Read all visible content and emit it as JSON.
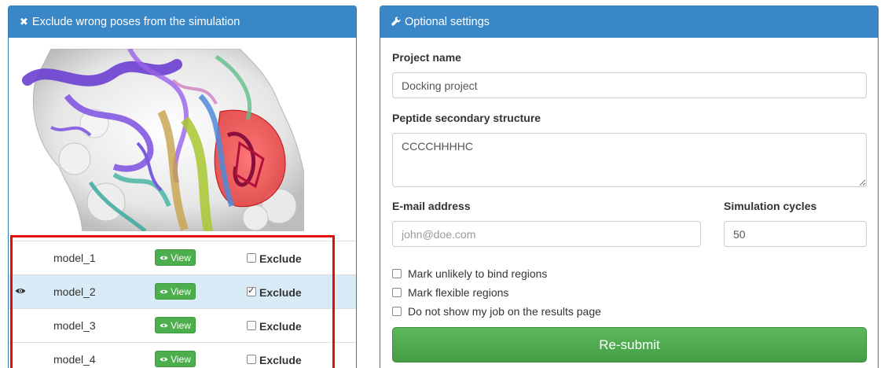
{
  "left_panel": {
    "title": "Exclude wrong poses from the simulation",
    "title_icon": "close-icon",
    "models": [
      {
        "name": "model_1",
        "view_label": "View",
        "exclude_label": "Exclude",
        "excluded": false,
        "selected": false
      },
      {
        "name": "model_2",
        "view_label": "View",
        "exclude_label": "Exclude",
        "excluded": true,
        "selected": true
      },
      {
        "name": "model_3",
        "view_label": "View",
        "exclude_label": "Exclude",
        "excluded": false,
        "selected": false
      },
      {
        "name": "model_4",
        "view_label": "View",
        "exclude_label": "Exclude",
        "excluded": false,
        "selected": false
      }
    ]
  },
  "right_panel": {
    "title": "Optional settings",
    "title_icon": "wrench-icon",
    "project_name": {
      "label": "Project name",
      "value": "Docking project"
    },
    "peptide_structure": {
      "label": "Peptide secondary structure",
      "value": "CCCCHHHHC"
    },
    "email": {
      "label": "E-mail address",
      "value": "",
      "placeholder": "john@doe.com"
    },
    "simulation_cycles": {
      "label": "Simulation cycles",
      "value": "50"
    },
    "checkboxes": [
      {
        "label": "Mark unlikely to bind regions",
        "checked": false
      },
      {
        "label": "Mark flexible regions",
        "checked": false
      },
      {
        "label": "Do not show my job on the results page",
        "checked": false
      }
    ],
    "submit_label": "Re-submit"
  },
  "colors": {
    "panel_header": "#3a87c8",
    "success": "#5cb85c",
    "highlight": "#e40d0d",
    "selected_row": "#d9ebf6"
  }
}
